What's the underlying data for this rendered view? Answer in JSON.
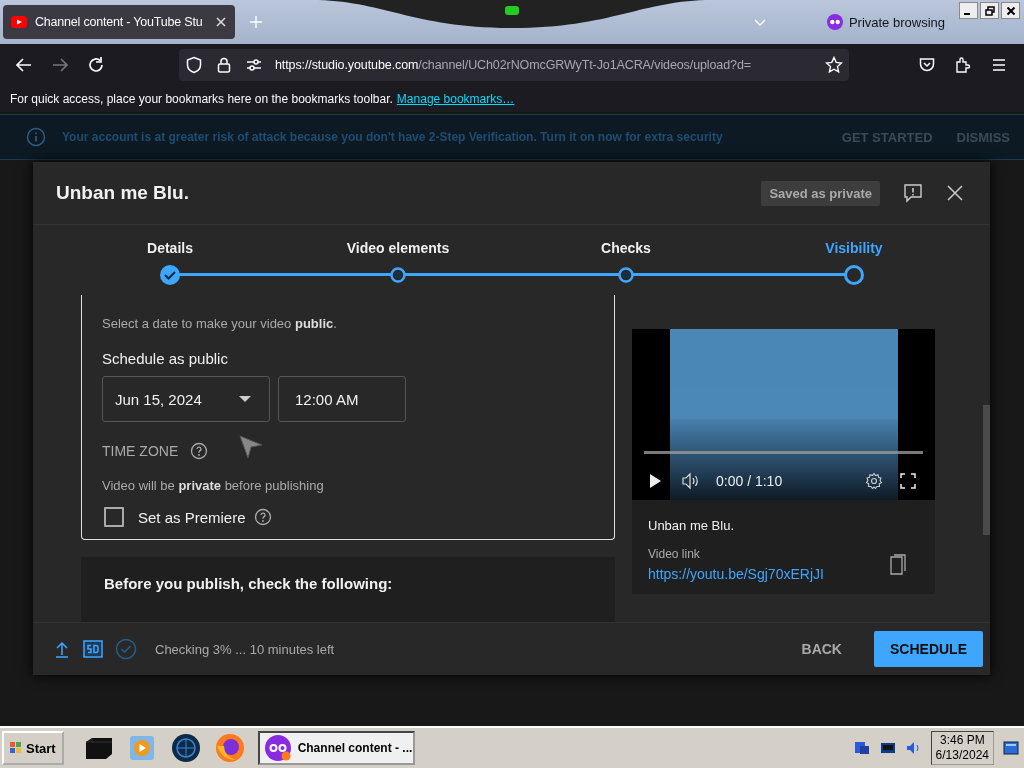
{
  "browser": {
    "tab_title": "Channel content - YouTube Stu",
    "private_label": "Private browsing",
    "url_host": "https://studio.youtube.com",
    "url_path": "/channel/UCh02rNOmcGRWyTt-Jo1ACRA/videos/upload?d=",
    "bookmarks_hint": "For quick access, place your bookmarks here on the bookmarks toolbar.",
    "bookmarks_link": "Manage bookmarks…"
  },
  "banner": {
    "message": "Your account is at greater risk of attack because you don't have 2-Step Verification. Turn it on now for extra security",
    "actions": [
      "GET STARTED",
      "DISMISS"
    ]
  },
  "dialog": {
    "title": "Unban me Blu.",
    "saved_badge": "Saved as private",
    "steps": [
      {
        "label": "Details",
        "done": true,
        "selected": false
      },
      {
        "label": "Video elements",
        "done": false,
        "selected": false
      },
      {
        "label": "Checks",
        "done": false,
        "selected": false
      },
      {
        "label": "Visibility",
        "done": false,
        "selected": true
      }
    ],
    "schedule": {
      "hint": "Select a date to make your video **public**.",
      "label": "Schedule as public",
      "date": "Jun 15, 2024",
      "time": "12:00 AM",
      "timezone_label": "TIME ZONE",
      "private_note": "Video will be **private** before publishing",
      "premiere": {
        "label": "Set as Premiere",
        "checked": false
      }
    },
    "checklist_title": "Before you publish, check the following:",
    "preview": {
      "time": "0:00 / 1:10",
      "video_title": "Unban me Blu.",
      "link_label": "Video link",
      "link": "https://youtu.be/Sgj70xERjJI"
    },
    "footer": {
      "status": "Checking 3% ... 10 minutes left",
      "back": "BACK",
      "schedule": "SCHEDULE"
    }
  },
  "taskbar": {
    "start": "Start",
    "window_title": "Channel content - ...",
    "time": "3:46 PM",
    "date": "6/13/2024"
  }
}
